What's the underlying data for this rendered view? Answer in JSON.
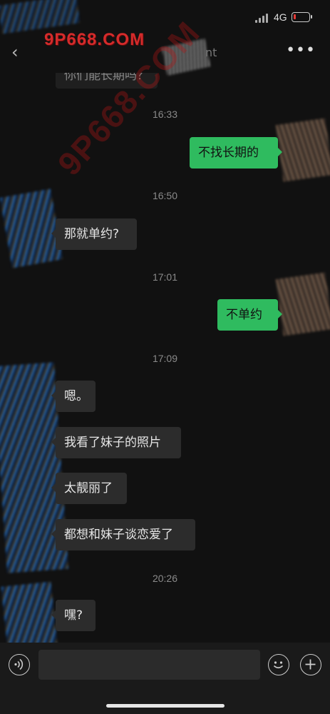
{
  "status_bar": {
    "network": "4G"
  },
  "watermarks": {
    "top": "9P668.COM",
    "diagonal": "9P668.COM"
  },
  "nav": {
    "title_fragment": "nt",
    "more_glyph": "•••",
    "back_glyph": "‹"
  },
  "messages": {
    "partial_top": "你们能长期吗？",
    "t1": "16:33",
    "m1": "不找长期的",
    "t2": "16:50",
    "m2": "那就单约?",
    "t3": "17:01",
    "m3": "不单约",
    "t4": "17:09",
    "m4": "嗯。",
    "m5": "我看了妹子的照片",
    "m6": "太靓丽了",
    "m7": "都想和妹子谈恋爱了",
    "t5": "20:26",
    "m8": "嘿?"
  },
  "input": {
    "value": "",
    "placeholder": ""
  },
  "colors": {
    "outgoing_bubble": "#2fbb5f",
    "incoming_bubble": "#2c2c2c",
    "background": "#111111",
    "battery_low": "#e53935"
  }
}
